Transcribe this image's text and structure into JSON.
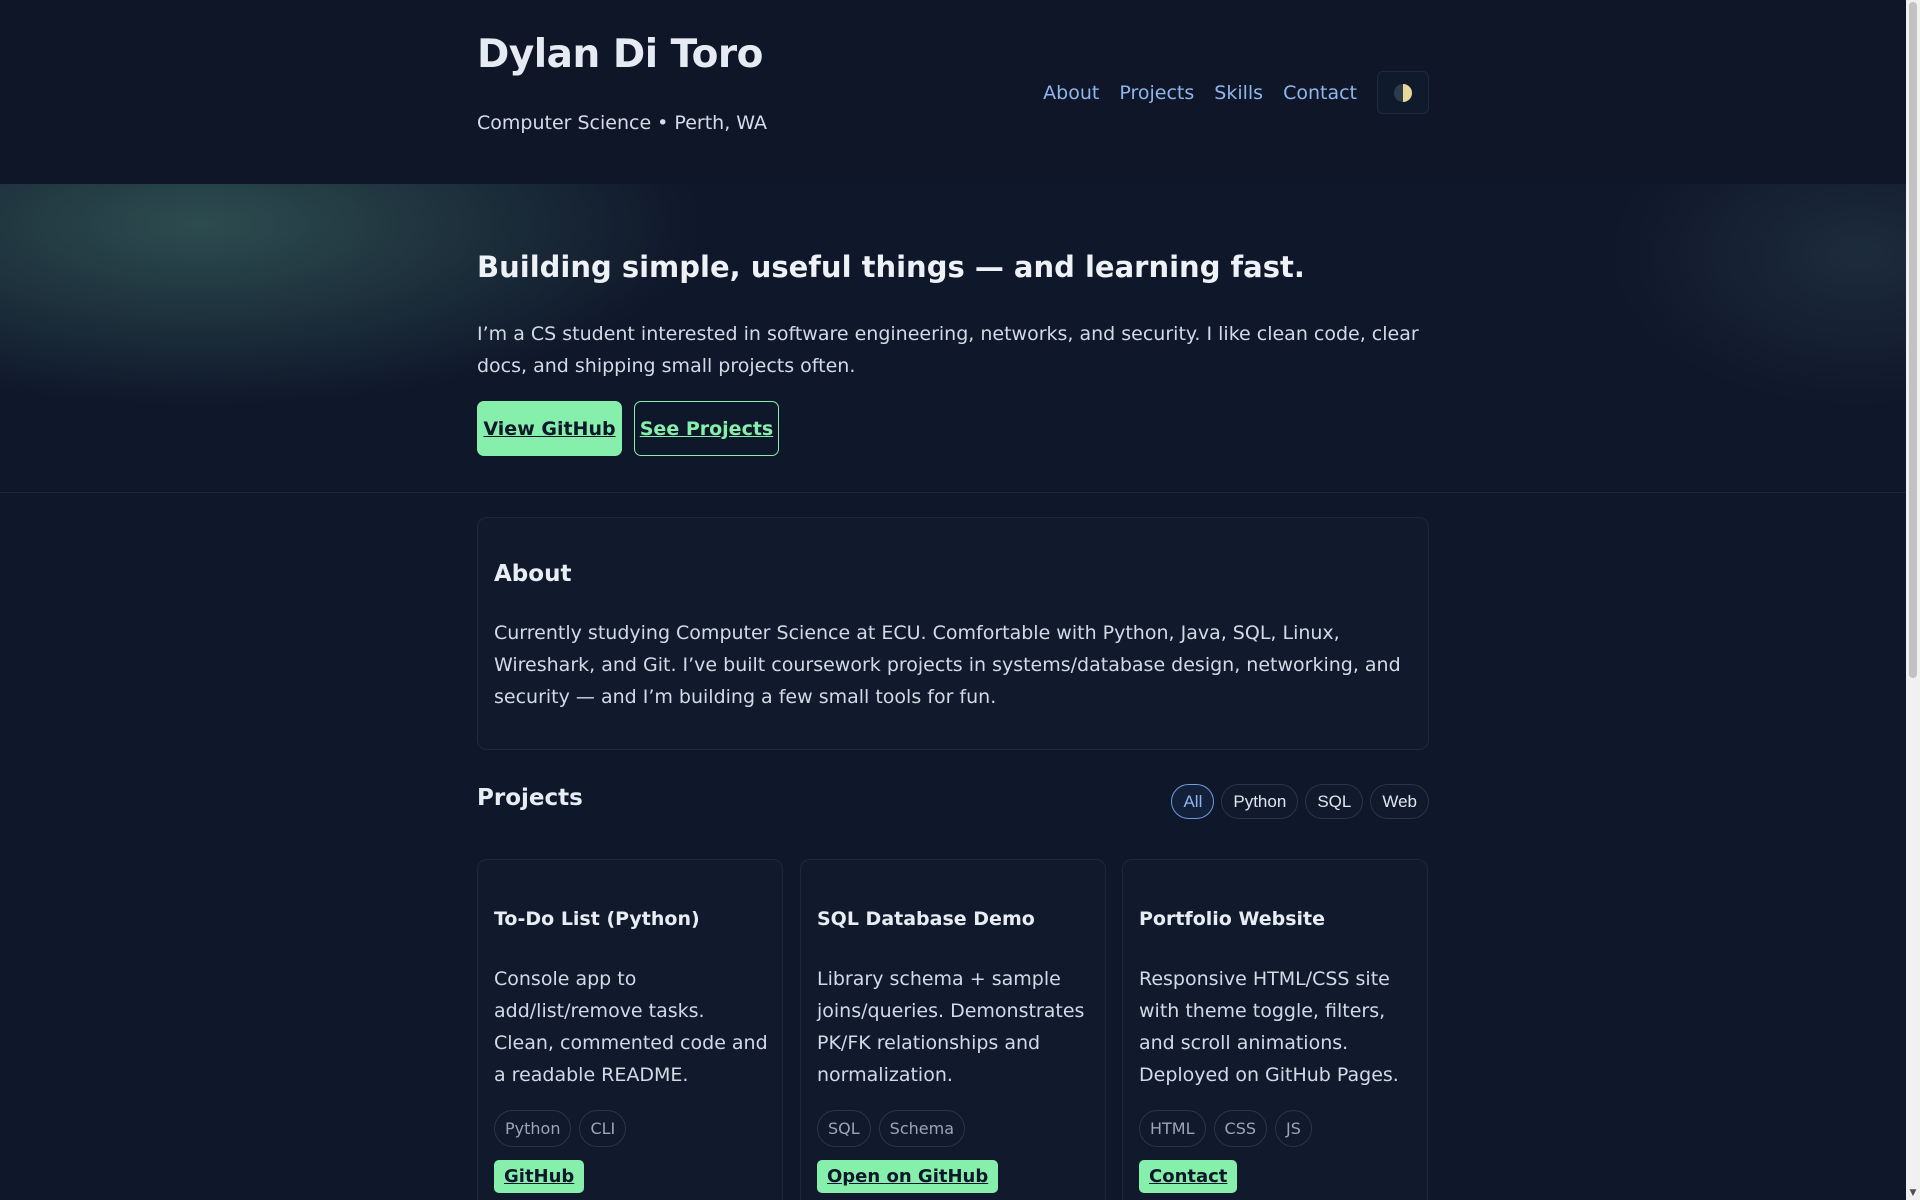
{
  "header": {
    "title": "Dylan Di Toro",
    "subtitle": "Computer Science • Perth, WA",
    "nav": [
      "About",
      "Projects",
      "Skills",
      "Contact"
    ],
    "theme_toggle_icon": "half-circle-theme-icon"
  },
  "hero": {
    "heading": "Building simple, useful things — and learning fast.",
    "text": "I’m a CS student interested in software engineering, networks, and security. I like clean code, clear docs, and shipping small projects often.",
    "primary_button": "View GitHub",
    "secondary_button": "See Projects"
  },
  "about": {
    "heading": "About",
    "text": "Currently studying Computer Science at ECU. Comfortable with Python, Java, SQL, Linux, Wireshark, and Git. I’ve built coursework projects in systems/database design, networking, and security — and I’m building a few small tools for fun."
  },
  "projects": {
    "heading": "Projects",
    "filters": [
      "All",
      "Python",
      "SQL",
      "Web"
    ],
    "active_filter": "All",
    "items": [
      {
        "title": "To-Do List (Python)",
        "description": "Console app to add/list/remove tasks. Clean, commented code and a readable README.",
        "tags": [
          "Python",
          "CLI"
        ],
        "link": "GitHub"
      },
      {
        "title": "SQL Database Demo",
        "description": "Library schema + sample joins/queries. Demonstrates PK/FK relationships and normalization.",
        "tags": [
          "SQL",
          "Schema"
        ],
        "link": "Open on GitHub"
      },
      {
        "title": "Portfolio Website",
        "description": "Responsive HTML/CSS site with theme toggle, filters, and scroll animations. Deployed on GitHub Pages.",
        "tags": [
          "HTML",
          "CSS",
          "JS"
        ],
        "link": "Contact"
      }
    ]
  },
  "colors": {
    "background": "#0f172a",
    "accent": "#86efac",
    "link": "#8fb6ec"
  }
}
